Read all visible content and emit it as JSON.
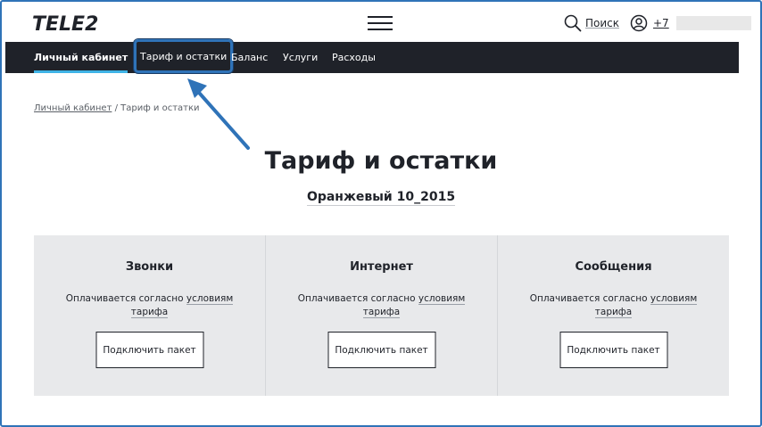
{
  "header": {
    "logo": "TELE2",
    "search_label": "Поиск",
    "phone_prefix": "+7"
  },
  "nav": {
    "items": [
      {
        "label": "Личный кабинет"
      },
      {
        "label": "Тариф и остатки"
      },
      {
        "label": "Баланс"
      },
      {
        "label": "Услуги"
      },
      {
        "label": "Расходы"
      }
    ]
  },
  "breadcrumb": {
    "root": "Личный кабинет",
    "separator": " / ",
    "current": "Тариф и остатки"
  },
  "main": {
    "title": "Тариф и остатки",
    "tariff_name": "Оранжевый 10_2015",
    "cards": [
      {
        "title": "Звонки",
        "desc_prefix": "Оплачивается согласно ",
        "desc_link1": "условиям",
        "desc_link2": "тарифа",
        "button": "Подключить пакет"
      },
      {
        "title": "Интернет",
        "desc_prefix": "Оплачивается согласно ",
        "desc_link1": "условиям",
        "desc_link2": "тарифа",
        "button": "Подключить пакет"
      },
      {
        "title": "Сообщения",
        "desc_prefix": "Оплачивается согласно ",
        "desc_link1": "условиям",
        "desc_link2": "тарифа",
        "button": "Подключить пакет"
      }
    ]
  },
  "colors": {
    "accent": "#3fb3e6",
    "nav_bg": "#1f2229",
    "annotation": "#2f73b8",
    "card_bg": "#e8e9eb"
  }
}
